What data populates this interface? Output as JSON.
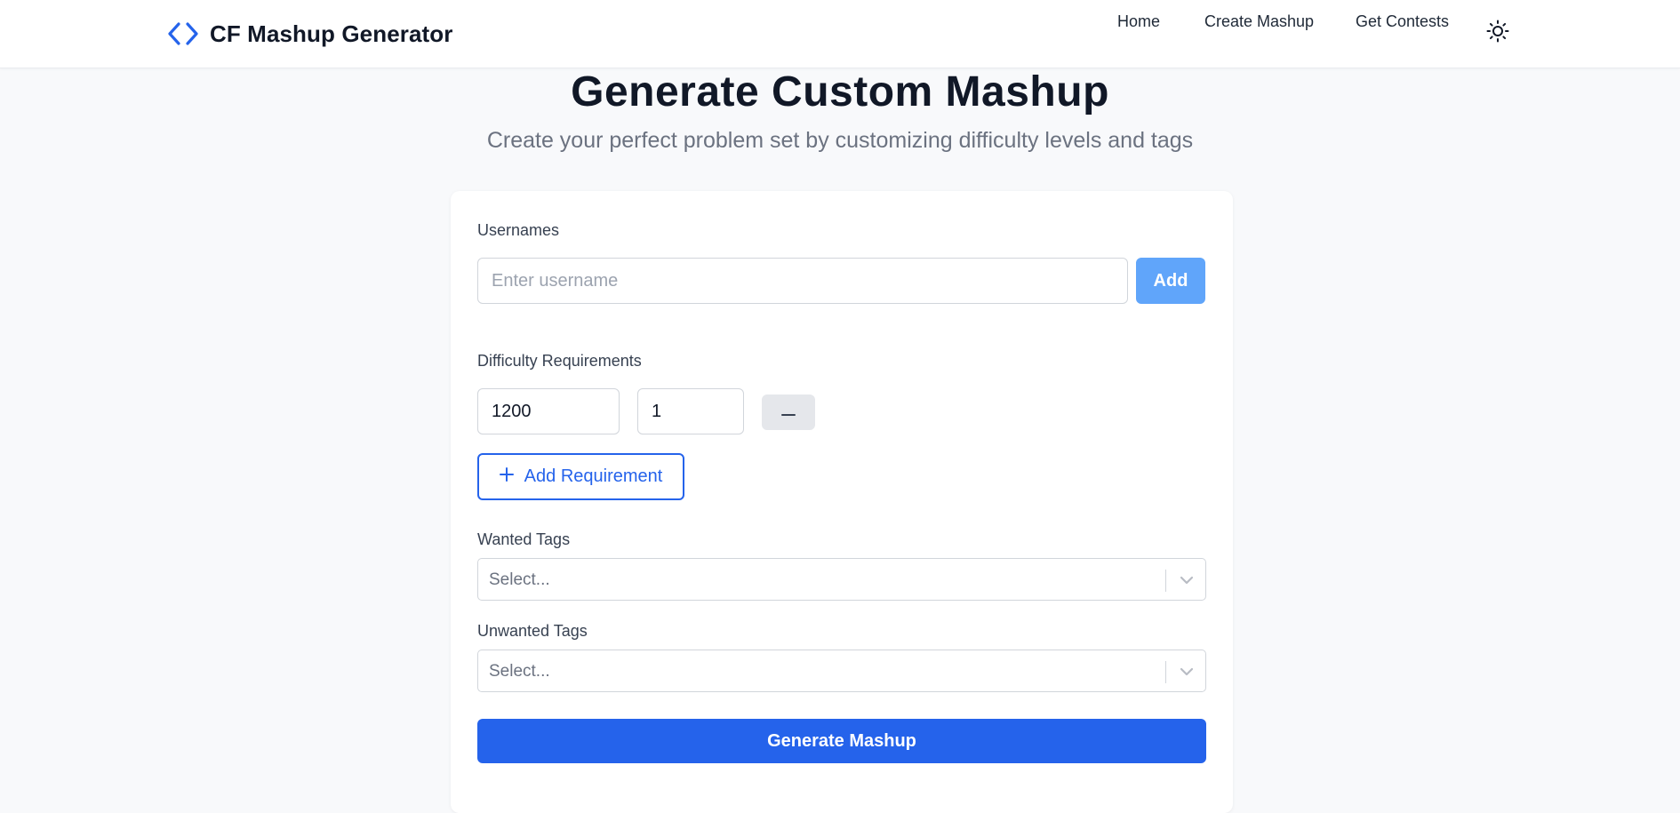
{
  "app": {
    "title": "CF Mashup Generator",
    "accent_color": "#2563eb",
    "brand_icon": "code-brackets-icon"
  },
  "nav": {
    "links": [
      {
        "label": "Home"
      },
      {
        "label": "Create Mashup"
      },
      {
        "label": "Get Contests"
      }
    ],
    "theme_toggle_icon": "sun-icon"
  },
  "header": {
    "title": "Generate Custom Mashup",
    "subtitle": "Create your perfect problem set by customizing difficulty levels and tags"
  },
  "form": {
    "usernames": {
      "label": "Usernames",
      "placeholder": "Enter username",
      "value": "",
      "add_label": "Add",
      "add_color": "#60a5fa"
    },
    "difficulty": {
      "label": "Difficulty Requirements",
      "requirements": [
        {
          "rating": "1200",
          "count": "1",
          "remove_icon": "minus-icon"
        }
      ],
      "add_requirement_label": "Add Requirement",
      "add_requirement_icon": "plus-icon"
    },
    "wanted_tags": {
      "label": "Wanted Tags",
      "placeholder": "Select...",
      "icon": "chevron-down-icon"
    },
    "unwanted_tags": {
      "label": "Unwanted Tags",
      "placeholder": "Select...",
      "icon": "chevron-down-icon"
    },
    "submit_label": "Generate Mashup"
  }
}
